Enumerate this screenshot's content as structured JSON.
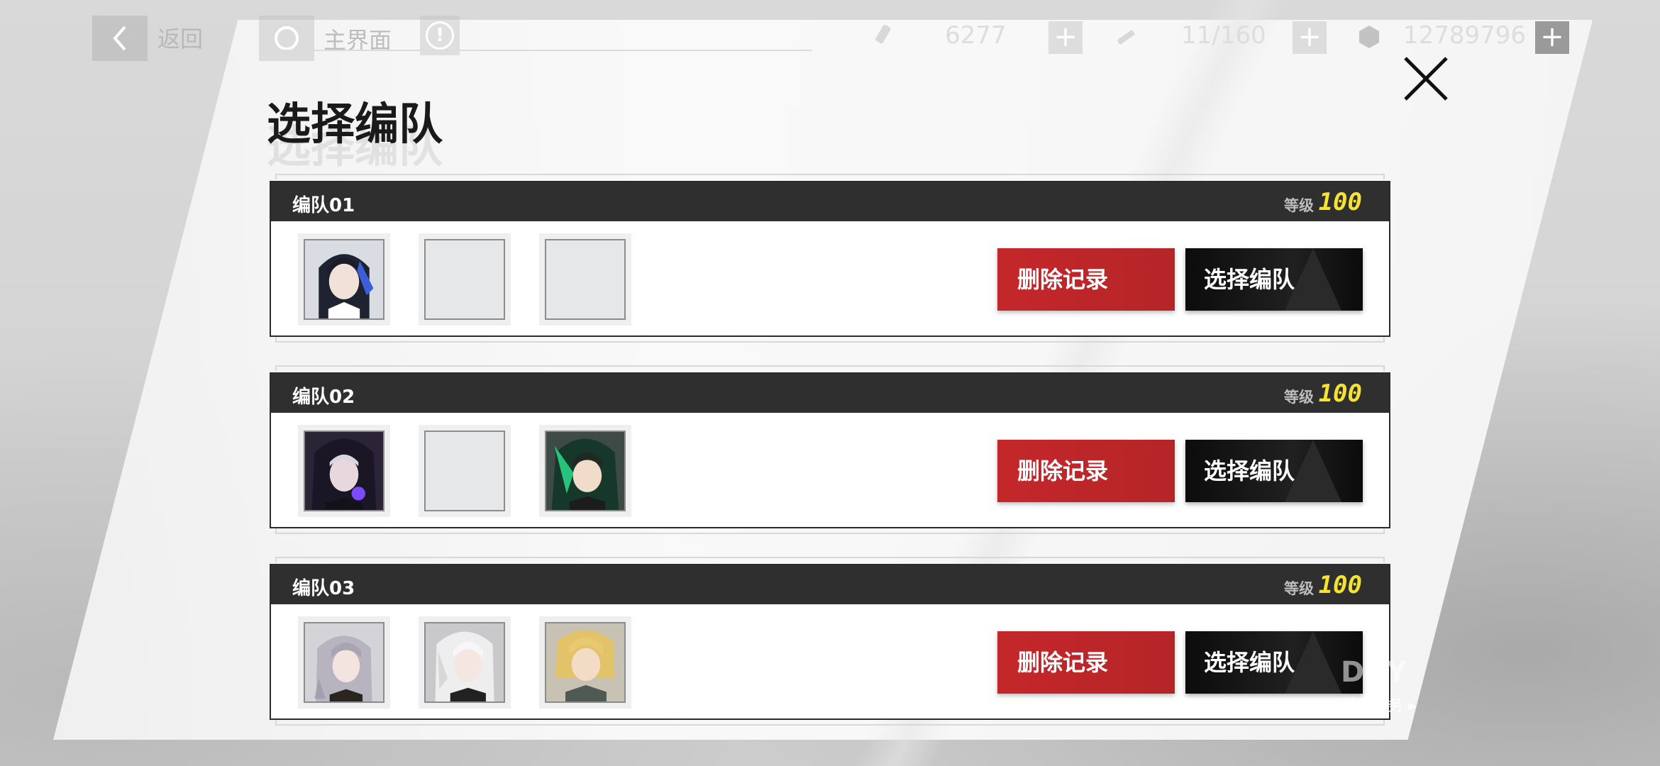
{
  "topbar": {
    "back_label": "返回",
    "home_label": "主界面",
    "info_glyph": "!",
    "resources": [
      {
        "icon": "stamina-icon",
        "value": "6277"
      },
      {
        "icon": "syringe-icon",
        "value": "11/160"
      },
      {
        "icon": "coin-icon",
        "value": "12789796"
      }
    ]
  },
  "page": {
    "title": "选择编队"
  },
  "squads": [
    {
      "name": "编队01",
      "level_label": "等级",
      "level": "100",
      "delete_label": "删除记录",
      "select_label": "选择编队",
      "members": [
        "filled",
        "empty",
        "empty"
      ]
    },
    {
      "name": "编队02",
      "level_label": "等级",
      "level": "100",
      "delete_label": "删除记录",
      "select_label": "选择编队",
      "members": [
        "filled",
        "empty",
        "filled"
      ]
    },
    {
      "name": "编队03",
      "level_label": "等级",
      "level": "100",
      "delete_label": "删除记录",
      "select_label": "选择编队",
      "members": [
        "filled",
        "filled",
        "filled"
      ]
    }
  ],
  "event": {
    "big": "DAY",
    "small": "活动任务 ▸"
  },
  "colors": {
    "delete": "#c4272a",
    "select": "#111111",
    "level": "#f6e231",
    "header": "#2f2f2f"
  }
}
